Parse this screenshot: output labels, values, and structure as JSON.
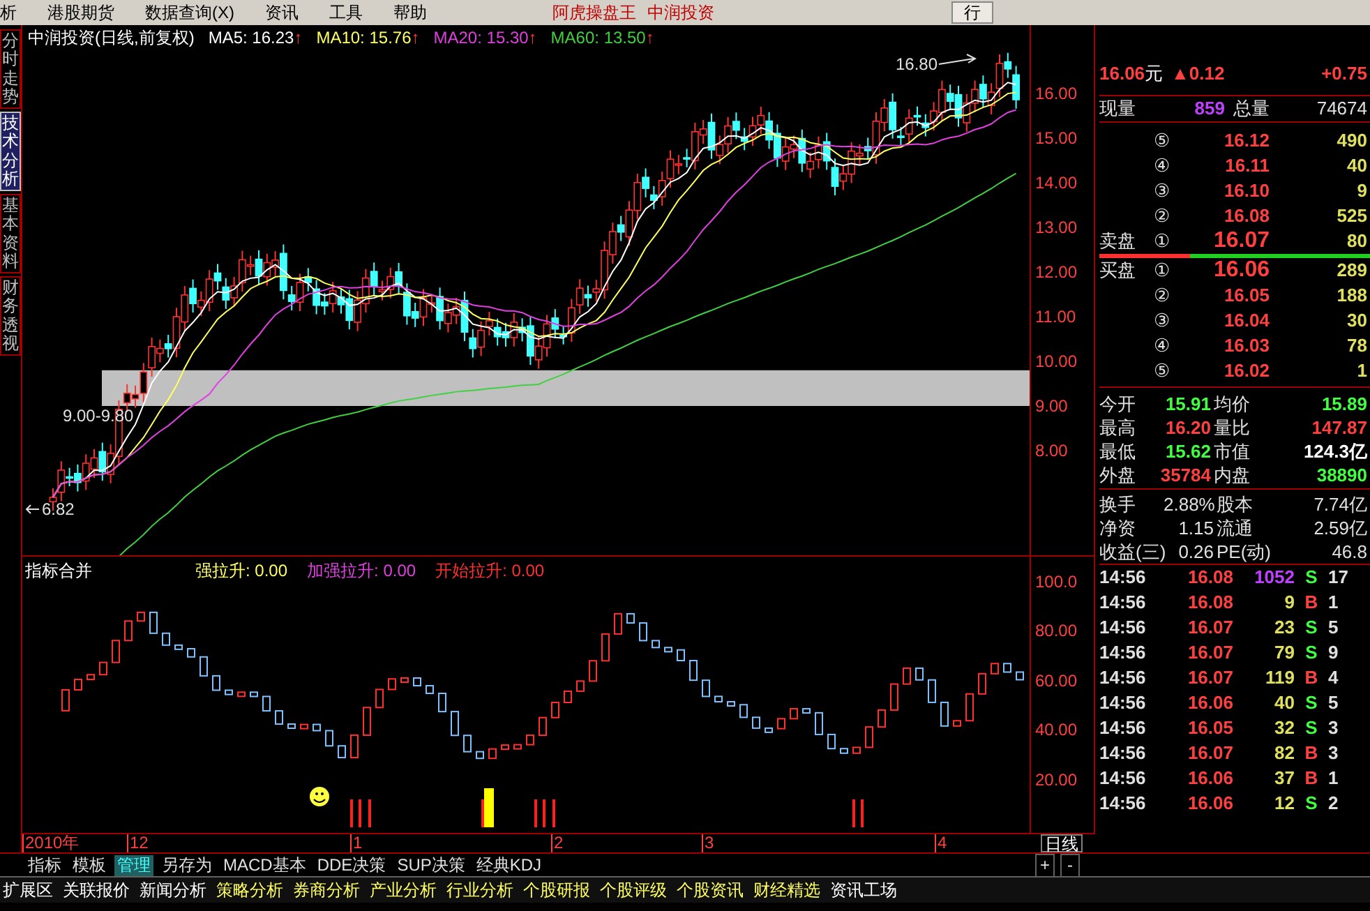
{
  "menu": {
    "items": [
      "析",
      "港股期货",
      "数据查询(X)",
      "资讯",
      "工具",
      "帮助"
    ],
    "title": [
      "阿虎操盘王",
      "中润投资"
    ],
    "button": "行"
  },
  "side_tabs": [
    {
      "label": "分时走势",
      "selected": false
    },
    {
      "label": "技术分析",
      "selected": true
    },
    {
      "label": "基本资料",
      "selected": false
    },
    {
      "label": "财务透视",
      "selected": false
    }
  ],
  "price_chart": {
    "title": "中润投资(日线,前复权)",
    "ma": [
      {
        "label": "MA5: 16.23",
        "arrow": "↑",
        "color": "#ffffff"
      },
      {
        "label": "MA10: 15.76",
        "arrow": "↑",
        "color": "#ffff60"
      },
      {
        "label": "MA20: 15.30",
        "arrow": "↑",
        "color": "#e040e0"
      },
      {
        "label": "MA60: 13.50",
        "arrow": "↑",
        "color": "#40d040"
      }
    ],
    "annotations": {
      "high": "16.80",
      "low": "6.82",
      "band": "9.00-9.80"
    },
    "axis": [
      "16.00",
      "15.00",
      "14.00",
      "13.00",
      "12.00",
      "11.00",
      "10.00",
      "9.00",
      "8.00"
    ]
  },
  "indicator": {
    "title": "指标合并",
    "values": [
      {
        "label": "强拉升: 0.00",
        "color": "#ffff60"
      },
      {
        "label": "加强拉升: 0.00",
        "color": "#e040e0"
      },
      {
        "label": "开始拉升: 0.00",
        "color": "#ff3030"
      }
    ],
    "axis": [
      "100.0",
      "80.00",
      "60.00",
      "40.00",
      "20.00"
    ]
  },
  "date_axis": {
    "labels": [
      "2010年",
      "12",
      "1",
      "2",
      "3",
      "4"
    ],
    "period": "日线"
  },
  "template_tabs": [
    {
      "label": "指标",
      "selected": false
    },
    {
      "label": "模板",
      "selected": false
    },
    {
      "label": "管理",
      "selected": true
    },
    {
      "label": "另存为",
      "selected": false
    },
    {
      "label": "MACD基本",
      "selected": false
    },
    {
      "label": "DDE决策",
      "selected": false
    },
    {
      "label": "SUP决策",
      "selected": false
    },
    {
      "label": "经典KDJ",
      "selected": false
    }
  ],
  "zoom_buttons": [
    "+",
    "-"
  ],
  "bottom_tabs": [
    {
      "label": "扩展区",
      "color": "#ffffff"
    },
    {
      "label": "关联报价",
      "color": "#ffffff"
    },
    {
      "label": "新闻分析",
      "color": "#ffffff"
    },
    {
      "label": "策略分析",
      "color": "#ffff60"
    },
    {
      "label": "券商分析",
      "color": "#ffff60"
    },
    {
      "label": "产业分析",
      "color": "#ffff60"
    },
    {
      "label": "行业分析",
      "color": "#ffff60"
    },
    {
      "label": "个股研报",
      "color": "#ffff60"
    },
    {
      "label": "个股评级",
      "color": "#ffff60"
    },
    {
      "label": "个股资讯",
      "color": "#ffff60"
    },
    {
      "label": "财经精选",
      "color": "#ffff60"
    },
    {
      "label": "资讯工场",
      "color": "#ffffff"
    }
  ],
  "quote": {
    "price": "16.06",
    "unit": "元",
    "change": "▲0.12",
    "percent": "+0.75",
    "volume": {
      "now_label": "现量",
      "now_value": "859",
      "total_label": "总量",
      "total_value": "74674"
    },
    "asks": [
      {
        "index": "⑤",
        "price": "16.12",
        "volume": "490"
      },
      {
        "index": "④",
        "price": "16.11",
        "volume": "40"
      },
      {
        "index": "③",
        "price": "16.10",
        "volume": "9"
      },
      {
        "index": "②",
        "price": "16.08",
        "volume": "525"
      },
      {
        "label": "卖盘",
        "index": "①",
        "price": "16.07",
        "volume": "80"
      }
    ],
    "bids": [
      {
        "label": "买盘",
        "index": "①",
        "price": "16.06",
        "volume": "289"
      },
      {
        "index": "②",
        "price": "16.05",
        "volume": "188"
      },
      {
        "index": "③",
        "price": "16.04",
        "volume": "30"
      },
      {
        "index": "④",
        "price": "16.03",
        "volume": "78"
      },
      {
        "index": "⑤",
        "price": "16.02",
        "volume": "1"
      }
    ],
    "stats": [
      {
        "label": "今开",
        "value": "15.91",
        "color": "#40ff40"
      },
      {
        "label": "均价",
        "value": "15.89",
        "color": "#40ff40"
      },
      {
        "label": "最高",
        "value": "16.20",
        "color": "#ff4040"
      },
      {
        "label": "量比",
        "value": "147.87",
        "color": "#ff4040"
      },
      {
        "label": "最低",
        "value": "15.62",
        "color": "#40ff40"
      },
      {
        "label": "市值",
        "value": "124.3亿",
        "color": "#ffffff"
      },
      {
        "label": "外盘",
        "value": "35784",
        "color": "#ff4040"
      },
      {
        "label": "内盘",
        "value": "38890",
        "color": "#40ff40"
      }
    ],
    "stats2": [
      {
        "label": "换手",
        "value": "2.88%"
      },
      {
        "label": "股本",
        "value": "7.74亿"
      },
      {
        "label": "净资",
        "value": "1.15"
      },
      {
        "label": "流通",
        "value": "2.59亿"
      },
      {
        "label": "收益(三)",
        "value": "0.26"
      },
      {
        "label": "PE(动)",
        "value": "46.8"
      }
    ],
    "ticks": [
      {
        "time": "14:56",
        "price": "16.08",
        "volume": "1052",
        "large": true,
        "side": "S",
        "kind": "sell",
        "extra": "17"
      },
      {
        "time": "14:56",
        "price": "16.08",
        "volume": "9",
        "large": false,
        "side": "B",
        "kind": "buy",
        "extra": "1"
      },
      {
        "time": "14:56",
        "price": "16.07",
        "volume": "23",
        "large": false,
        "side": "S",
        "kind": "sell",
        "extra": "5"
      },
      {
        "time": "14:56",
        "price": "16.07",
        "volume": "79",
        "large": false,
        "side": "S",
        "kind": "sell",
        "extra": "9"
      },
      {
        "time": "14:56",
        "price": "16.07",
        "volume": "119",
        "large": false,
        "side": "B",
        "kind": "buy",
        "extra": "4"
      },
      {
        "time": "14:56",
        "price": "16.06",
        "volume": "40",
        "large": false,
        "side": "S",
        "kind": "sell",
        "extra": "5"
      },
      {
        "time": "14:56",
        "price": "16.05",
        "volume": "32",
        "large": false,
        "side": "S",
        "kind": "sell",
        "extra": "3"
      },
      {
        "time": "14:56",
        "price": "16.07",
        "volume": "82",
        "large": false,
        "side": "B",
        "kind": "buy",
        "extra": "3"
      },
      {
        "time": "14:56",
        "price": "16.06",
        "volume": "37",
        "large": false,
        "side": "B",
        "kind": "buy",
        "extra": "1"
      },
      {
        "time": "14:56",
        "price": "16.06",
        "volume": "12",
        "large": false,
        "side": "S",
        "kind": "sell",
        "extra": "2"
      }
    ]
  }
}
